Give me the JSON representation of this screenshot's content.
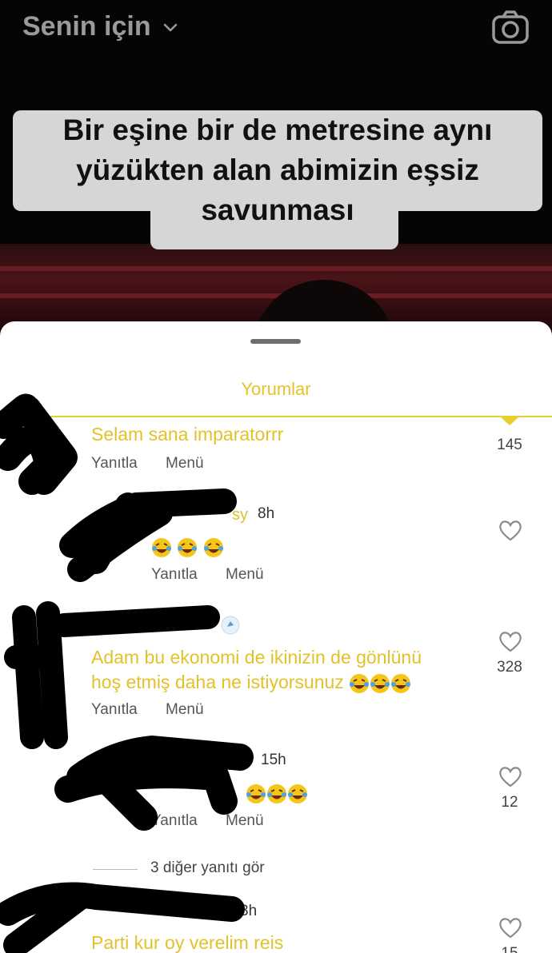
{
  "header": {
    "feed_label": "Senin için",
    "camera_icon": "camera-icon",
    "dropdown_icon": "chevron-down-icon"
  },
  "video": {
    "caption_line1": "Bir eşine bir de metresine aynı",
    "caption_line2": "yüzükten alan abimizin eşsiz",
    "caption_line3": "savunması"
  },
  "comments_panel": {
    "title": "Yorumlar",
    "comments": [
      {
        "text": "Selam sana imparatorrr",
        "likes": "145",
        "reply_label": "Yanıtla",
        "menu_label": "Menü"
      },
      {
        "username_partial": "sy",
        "time": "8h",
        "reply_label": "Yanıtla",
        "menu_label": "Menü"
      },
      {
        "text_line1": "Adam bu ekonomi de ikinizin de gönlünü",
        "text_line2": "hoş etmiş daha ne istiyorsunuz",
        "likes": "328",
        "reply_label": "Yanıtla",
        "menu_label": "Menü"
      },
      {
        "time": "15h",
        "likes": "12",
        "reply_label": "Yanıtla",
        "menu_label": "Menü"
      },
      {
        "time_partial": "3h",
        "text": "Parti kur oy verelim reis",
        "likes_partial": "15"
      }
    ],
    "view_more_replies": "3 diğer yanıtı gör"
  },
  "colors": {
    "accent_yellow": "#e3c12a",
    "sheet_bg": "#ffffff",
    "video_bg": "#050505"
  }
}
